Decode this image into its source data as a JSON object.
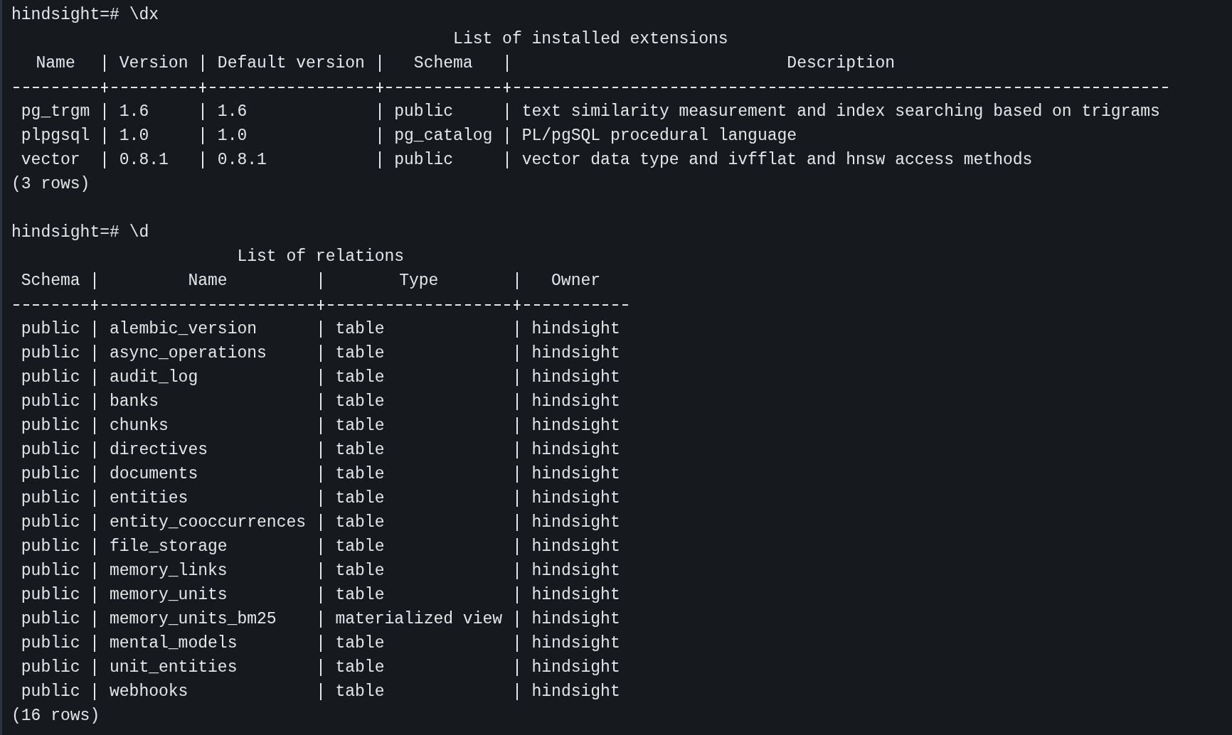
{
  "terminal": {
    "blocks": [
      {
        "prompt": "hindsight=# \\dx",
        "title": "List of installed extensions",
        "columns": [
          "Name",
          "Version",
          "Default version",
          "Schema",
          "Description"
        ],
        "rows": [
          [
            "pg_trgm",
            "1.6",
            "1.6",
            "public",
            "text similarity measurement and index searching based on trigrams"
          ],
          [
            "plpgsql",
            "1.0",
            "1.0",
            "pg_catalog",
            "PL/pgSQL procedural language"
          ],
          [
            "vector",
            "0.8.1",
            "0.8.1",
            "public",
            "vector data type and ivfflat and hnsw access methods"
          ]
        ],
        "footer": "(3 rows)"
      },
      {
        "prompt": "hindsight=# \\d",
        "title": "List of relations",
        "columns": [
          "Schema",
          "Name",
          "Type",
          "Owner"
        ],
        "rows": [
          [
            "public",
            "alembic_version",
            "table",
            "hindsight"
          ],
          [
            "public",
            "async_operations",
            "table",
            "hindsight"
          ],
          [
            "public",
            "audit_log",
            "table",
            "hindsight"
          ],
          [
            "public",
            "banks",
            "table",
            "hindsight"
          ],
          [
            "public",
            "chunks",
            "table",
            "hindsight"
          ],
          [
            "public",
            "directives",
            "table",
            "hindsight"
          ],
          [
            "public",
            "documents",
            "table",
            "hindsight"
          ],
          [
            "public",
            "entities",
            "table",
            "hindsight"
          ],
          [
            "public",
            "entity_cooccurrences",
            "table",
            "hindsight"
          ],
          [
            "public",
            "file_storage",
            "table",
            "hindsight"
          ],
          [
            "public",
            "memory_links",
            "table",
            "hindsight"
          ],
          [
            "public",
            "memory_units",
            "table",
            "hindsight"
          ],
          [
            "public",
            "memory_units_bm25",
            "materialized view",
            "hindsight"
          ],
          [
            "public",
            "mental_models",
            "table",
            "hindsight"
          ],
          [
            "public",
            "unit_entities",
            "table",
            "hindsight"
          ],
          [
            "public",
            "webhooks",
            "table",
            "hindsight"
          ]
        ],
        "footer": "(16 rows)"
      }
    ]
  }
}
